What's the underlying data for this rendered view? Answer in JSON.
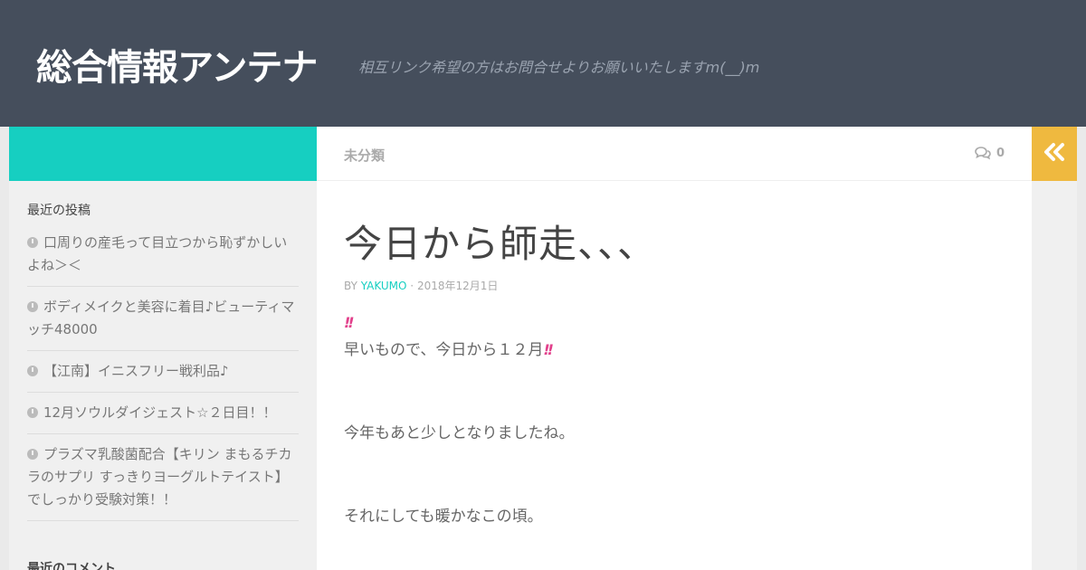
{
  "header": {
    "site_title": "総合情報アンテナ",
    "tagline": "相互リンク希望の方はお問合せよりお願いいたしますm(__)m"
  },
  "topbar": {
    "category": "未分類",
    "comments_count": "0",
    "comments_icon": "speech-bubbles-icon",
    "sidebar_toggle_icon": "double-chevron-left-icon"
  },
  "post": {
    "title": "今日から師走、、、",
    "byline_prefix": "BY",
    "author": "YAKUMO",
    "separator": " · ",
    "date": "2018年12月1日",
    "bangs": "!!",
    "line1": "早いもので、今日から１２月",
    "line2": "今年もあと少しとなりましたね。",
    "line3": "それにしても暖かなこの頃。"
  },
  "sidebar": {
    "recent_posts_title": "最近の投稿",
    "recent_posts": [
      "口周りの産毛って目立つから恥ずかしいよね＞＜",
      "ボディメイクと美容に着目♪ビューティマッチ48000",
      "【江南】イニスフリー戦利品♪",
      "12月ソウルダイジェスト☆２日目！！",
      "プラズマ乳酸菌配合【キリン まもるチカラのサプリ すっきりヨーグルトテイスト】でしっかり受験対策！！"
    ],
    "recent_comments_title": "最近のコメント"
  },
  "colors": {
    "header_bg": "#454e5c",
    "accent_teal": "#16cfc1",
    "accent_orange": "#efb93f",
    "bangs_pink": "#e2418c"
  }
}
